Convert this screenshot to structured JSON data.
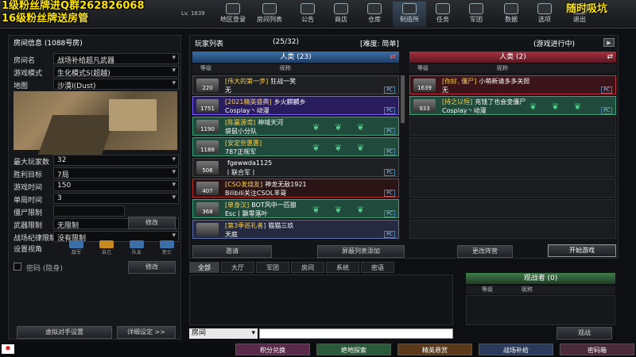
{
  "overlay": {
    "line1": "1级粉丝牌进Q群262826068",
    "line2": "16级粉丝牌送房管",
    "right": "随时吸坑"
  },
  "header": {
    "level": "Lv. 1639"
  },
  "nav": [
    {
      "label": "地区登录"
    },
    {
      "label": "房间列表"
    },
    {
      "label": "公告"
    },
    {
      "label": "商店"
    },
    {
      "label": "仓库"
    },
    {
      "label": "制造所"
    },
    {
      "label": "任务"
    },
    {
      "label": "军团"
    },
    {
      "label": "数据"
    },
    {
      "label": "选项"
    },
    {
      "label": "退出"
    }
  ],
  "room": {
    "title": "房间信息 (1088号房)",
    "fields": [
      {
        "label": "房间名",
        "value": "战场补给超凡武器"
      },
      {
        "label": "游戏模式",
        "value": "生化模式S(超越)"
      },
      {
        "label": "地图",
        "value": "沙漠Ⅰ(Dust)"
      },
      {
        "label": "最大玩家数",
        "value": "32"
      },
      {
        "label": "胜利目标",
        "value": "7局"
      },
      {
        "label": "游戏时间",
        "value": "150"
      },
      {
        "label": "单局时间",
        "value": "3"
      },
      {
        "label": "僵尸限制",
        "value": ""
      },
      {
        "label": "武器限制",
        "value": "无限制"
      },
      {
        "label": "战场纪律限制",
        "value": "没有限制"
      }
    ],
    "edit": "修改",
    "view_label": "设置视角",
    "views": [
      "敌军",
      "自己",
      "队友",
      "死亡"
    ],
    "password": "密码 (隐身)",
    "password_edit": "修改",
    "observe_btn": "虚拟对手设置",
    "detail_btn": "详细设定 >>"
  },
  "players": {
    "title": "玩家列表",
    "count": "(25/32)",
    "difficulty": "[难度: 简单]",
    "status": "(游戏进行中)",
    "human_team": "人类 (23)",
    "zombie_team": "人类 (2)",
    "col_rank": "等级",
    "col_name": "昵称",
    "humans": [
      {
        "rank": "220",
        "clan": "[伟大的第一步]",
        "name": "狂战一笑",
        "sub": "无",
        "bg": "#1e2023",
        "bd": "#444"
      },
      {
        "rank": "1751",
        "clan": "[2021精英盛典]",
        "name": "乡火麒麟乡",
        "sub": "Cosplay丶动漫",
        "bg": "#2a1d5e",
        "bd": "#7a5cff"
      },
      {
        "rank": "1190",
        "clan": "[陈赢源鸢]",
        "name": "神域天河",
        "sub": "袋鼠小分队",
        "bg": "#1f4a3c",
        "bd": "#3fa07a"
      },
      {
        "rank": "1188",
        "clan": "[安定奈惠惠]",
        "name": "",
        "sub": "787正规军",
        "bg": "#1f4a3c",
        "bd": "#3fa07a"
      },
      {
        "rank": "506",
        "clan": "",
        "name": "fgewwda1125",
        "sub": "丨联合军丨",
        "bg": "#1e2023",
        "bd": "#444"
      },
      {
        "rank": "407",
        "clan": "[CSO发烧友]",
        "name": "神龙无敌1921",
        "sub": "Bilibili关注CSOL羊哥",
        "bg": "#2a1416",
        "bd": "#b03030"
      },
      {
        "rank": "368",
        "clan": "[单身汉]",
        "name": "BOT风中一匹狼",
        "sub": "Esc丨飘零落叶",
        "bg": "#1f4a3c",
        "bd": "#3fa07a"
      },
      {
        "rank": "",
        "clan": "[第3季巡礼者]",
        "name": "猫猫三玖",
        "sub": "天庭",
        "bg": "#252a40",
        "bd": "#5a6fa8"
      }
    ],
    "zombies": [
      {
        "rank": "1639",
        "clan": "[你好, 僵尸]",
        "name": "小萌新请多多关照",
        "sub": "无",
        "bg": "#3a1418",
        "bd": "#c03040"
      },
      {
        "rank": "933",
        "clan": "[持之以恒]",
        "name": "充钱了也会变僵尸",
        "sub": "Cosplay丶动漫",
        "bg": "#1f4a3c",
        "bd": "#3fa07a"
      }
    ],
    "invite": "邀请",
    "block": "屏蔽列表添加",
    "change_team": "更改阵营",
    "start": "开始游戏"
  },
  "chat": {
    "tabs": [
      "全部",
      "大厅",
      "军团",
      "房间",
      "系统",
      "密语"
    ],
    "channel": "房间",
    "spectator": "观战者 (0)",
    "col_rank": "等级",
    "col_name": "昵称",
    "spectate_btn": "观战"
  },
  "taskbar": [
    "积分兑换",
    "绝地探索",
    "精英悬赏",
    "战场补给",
    "密码箱"
  ],
  "colors": {
    "accent": "#4a7fa8",
    "zombie": "#c03040",
    "green": "#3fa07a",
    "yellow": "#ffe400"
  }
}
